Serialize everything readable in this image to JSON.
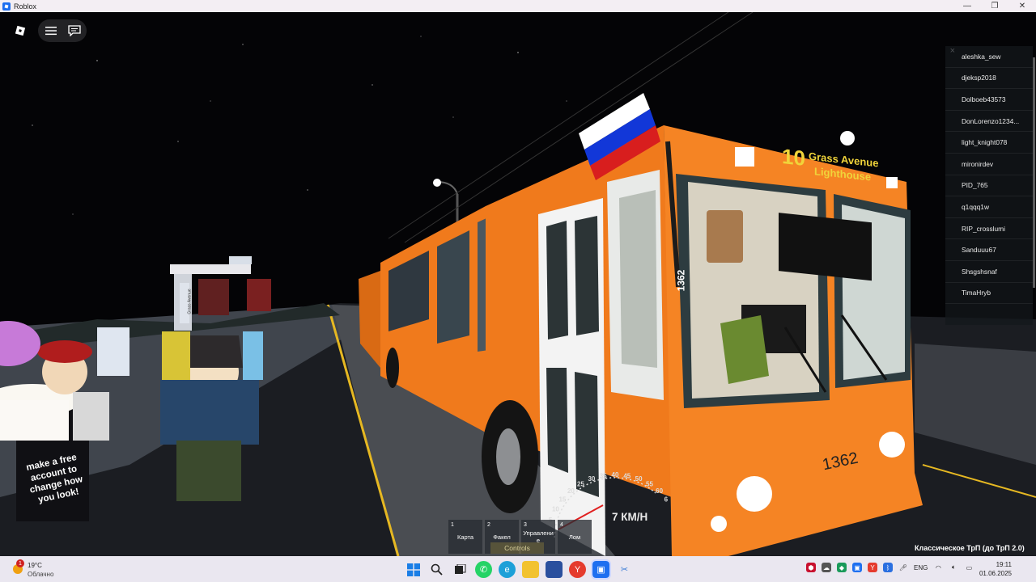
{
  "window": {
    "title": "Roblox",
    "minimize": "—",
    "maximize": "❐",
    "close": "✕"
  },
  "game": {
    "player_list": {
      "close_glyph": "×",
      "players": [
        "aleshka_sew",
        "djeksp2018",
        "Dolboeb43573",
        "DonLorenzo1234...",
        "light_knight078",
        "mironirdev",
        "PID_765",
        "q1qqq1w",
        "RIP_crosslumi",
        "Sanduuu67",
        "Shsgshsnaf",
        "TimaHryb"
      ]
    },
    "hotbar": [
      {
        "num": "1",
        "label": "Карта"
      },
      {
        "num": "2",
        "label": "Факел"
      },
      {
        "num": "3",
        "label": "Управлени е"
      },
      {
        "num": "4",
        "label": "Лом"
      }
    ],
    "controls_label": "Controls",
    "speed": "7 КМ/Н",
    "speedometer_ticks": [
      "5",
      "10",
      "15",
      "20",
      "25",
      "30",
      "35",
      "40",
      "45",
      "50",
      "55",
      "60",
      "65",
      "70",
      "75"
    ],
    "route_name": "Классическое ТрП (до ТрП 2.0)",
    "bus": {
      "route_number": "10",
      "destination_line1": "Grass Avenue",
      "destination_line2": "Lighthouse",
      "fleet_number": "1362",
      "color": "#f07a1c"
    },
    "shirt_text": [
      "make a free",
      "account to",
      "change how",
      "you look!"
    ],
    "stop_sign_text": "Grass Avenue"
  },
  "taskbar": {
    "weather": {
      "alert_count": "1",
      "temperature": "19°C",
      "condition": "Облачно"
    },
    "tray_language": "ENG",
    "time": "19:11",
    "date": "01.06.2025"
  }
}
